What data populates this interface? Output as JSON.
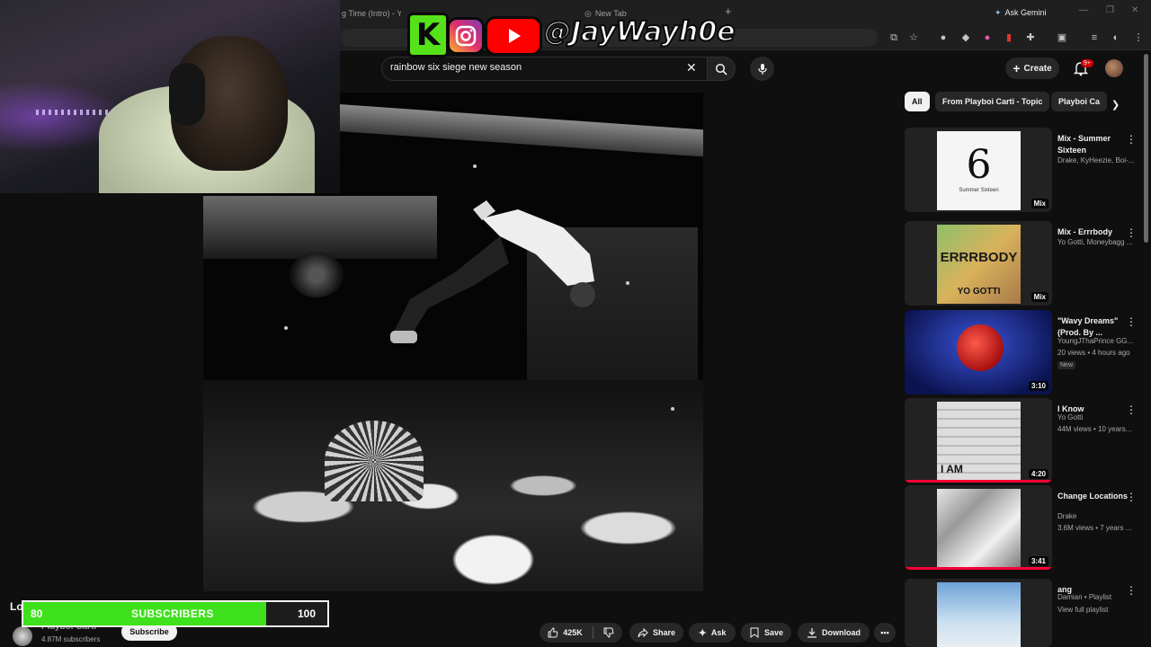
{
  "browser": {
    "tabs": [
      {
        "label": "g Time (Intro) - You"
      },
      {
        "label": "New Tab"
      }
    ],
    "ask_gemini": "Ask Gemini"
  },
  "social": {
    "ko_text": "K",
    "handle": "@JayWayh0e"
  },
  "search": {
    "query": "rainbow six siege new season"
  },
  "masthead": {
    "create_label": "Create",
    "notif_badge": "9+"
  },
  "video": {
    "title_partial": "Lo",
    "channel_name": "Playboi Carti",
    "channel_subs": "4.87M subscribers",
    "subscribe_label": "Subscribe"
  },
  "sub_goal": {
    "current": "80",
    "label": "SUBSCRIBERS",
    "goal": "100",
    "progress": 0.8,
    "bar_color": "#3ee11b"
  },
  "actions": {
    "likes": "425K",
    "share": "Share",
    "ask": "Ask",
    "save": "Save",
    "download": "Download"
  },
  "chips": [
    {
      "label": "All"
    },
    {
      "label": "From Playboi Carti - Topic"
    },
    {
      "label": "Playboi Ca"
    }
  ],
  "recommendations": [
    {
      "title": "Mix - Summer Sixteen",
      "channel": "Drake, KyHeezie, Boi-...",
      "meta": "",
      "badge": "Mix",
      "art_text": "6",
      "art_sub": "Summer Sixteen"
    },
    {
      "title": "Mix - Errrbody",
      "channel": "Yo Gotti, Moneybagg ...",
      "meta": "",
      "badge": "Mix",
      "art_text": "ERRRBODY",
      "art_sub": "YO GOTTI"
    },
    {
      "title": "\"Wavy Dreams\" (Prod. By ...",
      "channel": "YoungJThaPrince GG...",
      "meta": "20 views • 4 hours ago",
      "badge": "3:10",
      "new_label": "New"
    },
    {
      "title": "I Know",
      "channel": "Yo Gotti",
      "meta": "44M views • 10 years...",
      "badge": "4:20",
      "art_text": "I AM"
    },
    {
      "title": "Change Locations",
      "channel": "Drake",
      "meta": "3.6M views • 7 years ...",
      "badge": "3:41"
    },
    {
      "title": "ang",
      "channel": "Damian • Playlist",
      "meta": "View full playlist",
      "badge": ""
    }
  ],
  "colors": {
    "accent": "#ff0000",
    "progress_red": "#ff0033"
  }
}
